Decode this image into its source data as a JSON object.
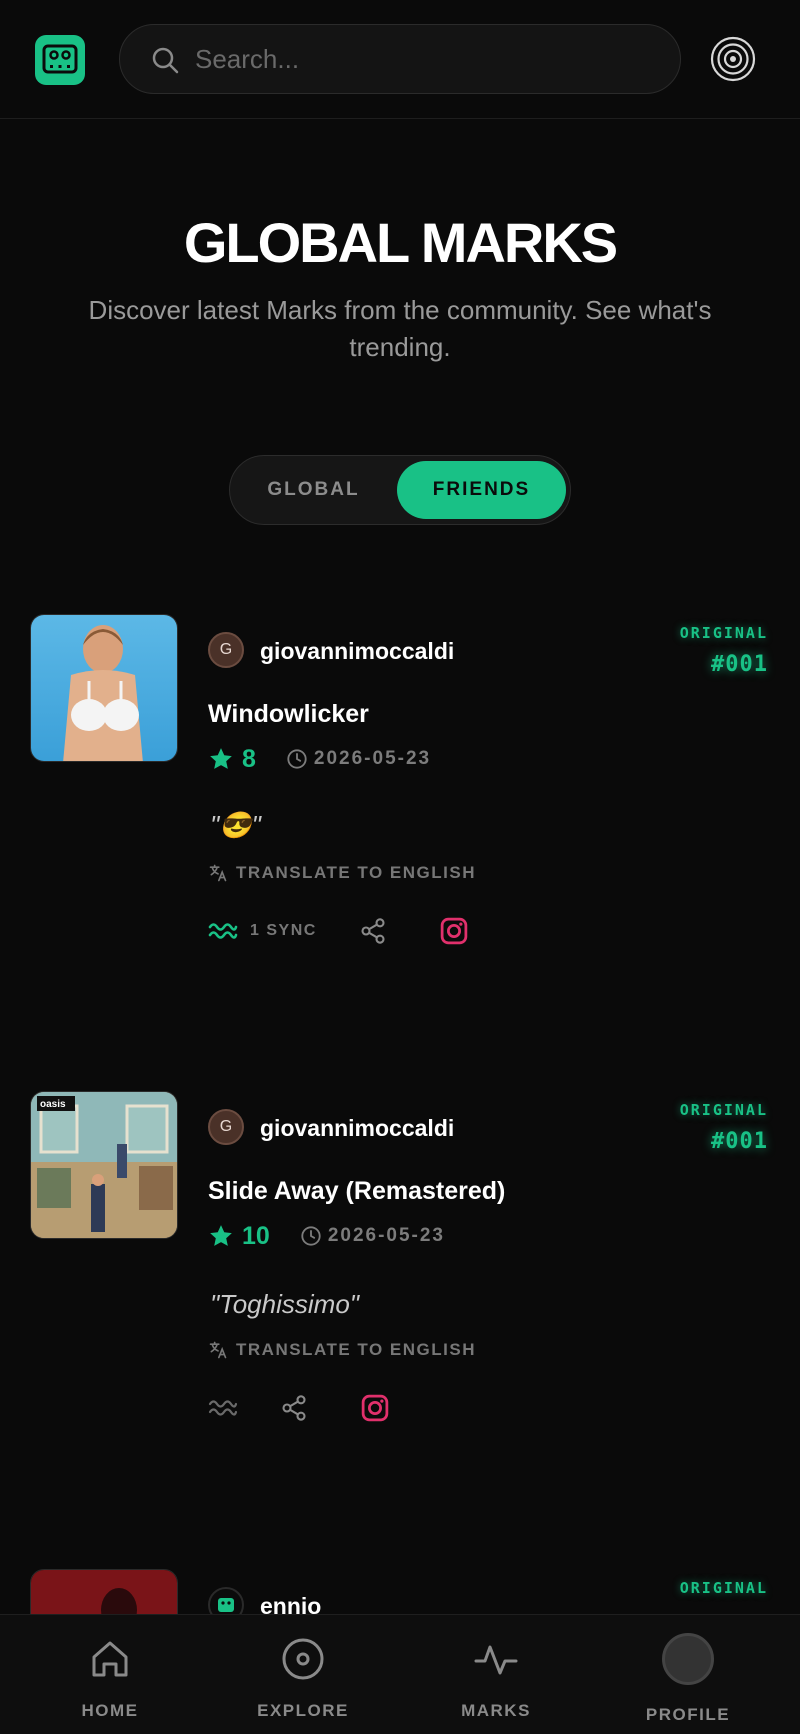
{
  "header": {
    "search_placeholder": "Search..."
  },
  "hero": {
    "title": "GLOBAL MARKS",
    "subtitle": "Discover latest Marks from the community. See what's trending."
  },
  "toggle": {
    "global_label": "GLOBAL",
    "friends_label": "FRIENDS",
    "active": "FRIENDS"
  },
  "marks": [
    {
      "avatar_letter": "G",
      "username": "giovannimoccaldi",
      "badge": "ORIGINAL",
      "number": "#001",
      "song": "Windowlicker",
      "rating": "8",
      "date": "2026-05-23",
      "quote": "\"😎\"",
      "translate_label": "TRANSLATE TO ENGLISH",
      "sync_label": "1 SYNC",
      "cover": "windowlicker-cover"
    },
    {
      "avatar_letter": "G",
      "username": "giovannimoccaldi",
      "badge": "ORIGINAL",
      "number": "#001",
      "song": "Slide Away (Remastered)",
      "rating": "10",
      "date": "2026-05-23",
      "quote": "\"Toghissimo\"",
      "translate_label": "TRANSLATE TO ENGLISH",
      "cover": "definitely-maybe-cover",
      "cover_text": "oasis"
    },
    {
      "username": "ennio",
      "badge": "ORIGINAL",
      "cover": "red-cover"
    }
  ],
  "bottom_nav": [
    {
      "label": "HOME",
      "icon": "home-icon"
    },
    {
      "label": "EXPLORE",
      "icon": "explore-icon"
    },
    {
      "label": "MARKS",
      "icon": "pulse-icon"
    },
    {
      "label": "PROFILE",
      "icon": "profile-avatar"
    }
  ],
  "colors": {
    "accent": "#19c186",
    "background": "#0a0a0a",
    "instagram": "#e1306c"
  }
}
